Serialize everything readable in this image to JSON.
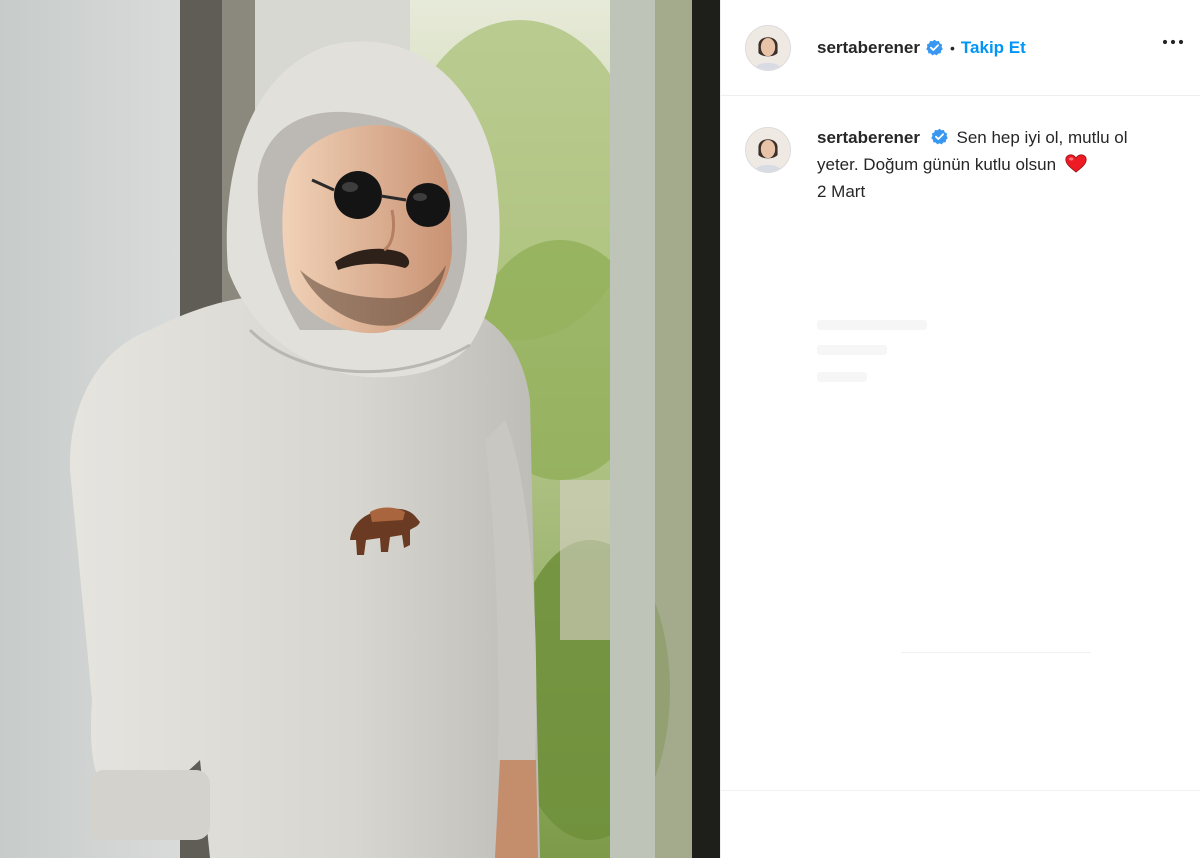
{
  "post": {
    "author": {
      "username": "sertaberener",
      "verified": true,
      "follow_label": "Takip Et",
      "separator": "•"
    },
    "caption": {
      "text": "Sen hep iyi ol, mutlu ol yeter. Doğum günün kutlu olsun",
      "emoji": "heart-emoji",
      "date": "2 Mart"
    },
    "icons": {
      "verified": "verified-badge-icon",
      "more": "more-options-icon"
    }
  },
  "colors": {
    "link_blue": "#0095f6",
    "verified_blue": "#3897f0",
    "heart_red": "#ed1c24",
    "text": "#262626",
    "border": "#efefef"
  }
}
